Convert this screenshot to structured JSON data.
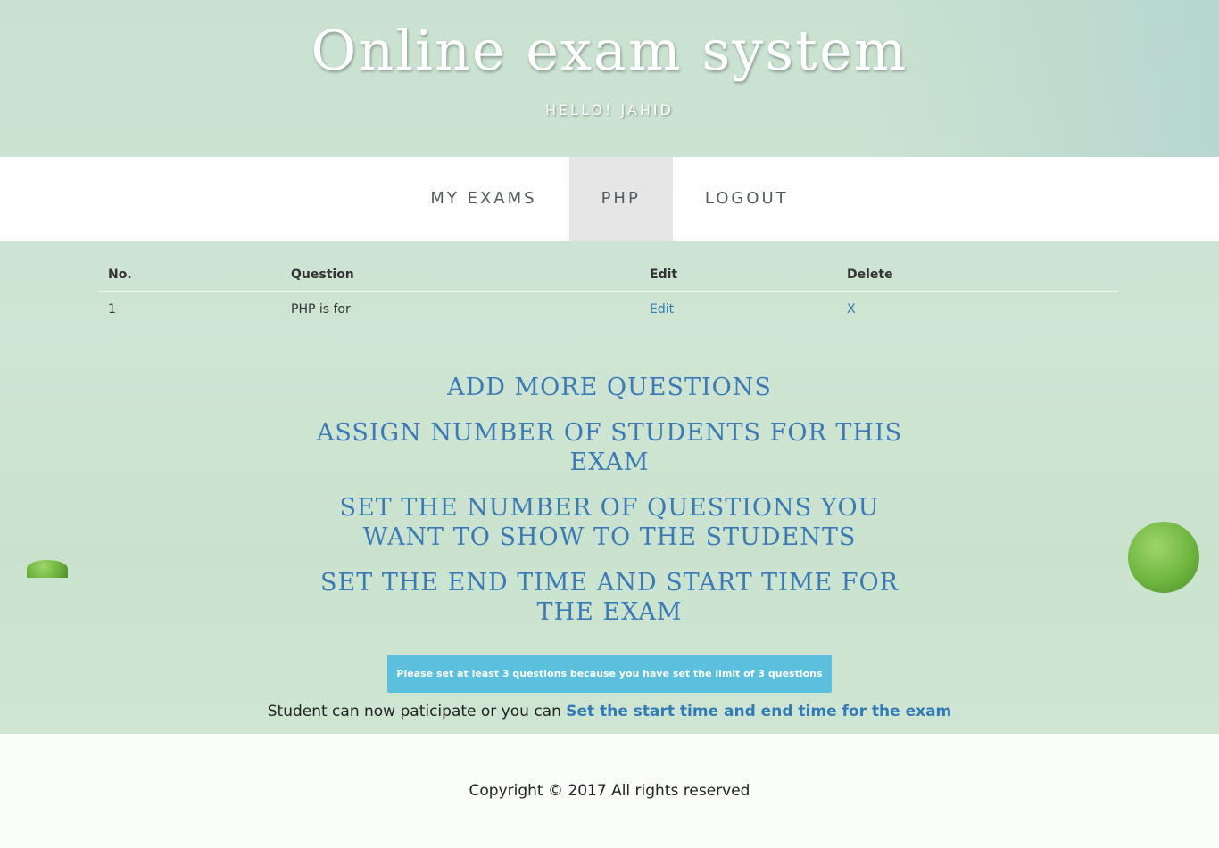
{
  "header": {
    "title": "Online exam system",
    "greeting": "HELLO! JAHID"
  },
  "nav": {
    "items": [
      {
        "label": "MY EXAMS",
        "active": false
      },
      {
        "label": "PHP",
        "active": true
      },
      {
        "label": "LOGOUT",
        "active": false
      }
    ]
  },
  "table": {
    "headers": {
      "no": "No.",
      "question": "Question",
      "edit": "Edit",
      "delete": "Delete"
    },
    "rows": [
      {
        "no": "1",
        "question": "PHP is for",
        "edit": "Edit",
        "delete": "X"
      }
    ]
  },
  "actions": {
    "add_questions": "ADD MORE QUESTIONS",
    "assign_students": "ASSIGN NUMBER OF STUDENTS FOR THIS EXAM",
    "set_question_count": "SET THE NUMBER OF QUESTIONS YOU WANT TO SHOW TO THE STUDENTS",
    "set_time": "SET THE END TIME AND START TIME FOR THE EXAM"
  },
  "alert": {
    "message": "Please set at least 3 questions because you have set the limit of 3 questions"
  },
  "status": {
    "text": "Student can now paticipate or you can ",
    "link": "Set the start time and end time for the exam"
  },
  "footer": {
    "copyright": "Copyright © 2017 All rights reserved"
  },
  "colors": {
    "link": "#337ab7",
    "alert_bg": "#5bc0de",
    "nav_active_bg": "#e6e6e6"
  }
}
